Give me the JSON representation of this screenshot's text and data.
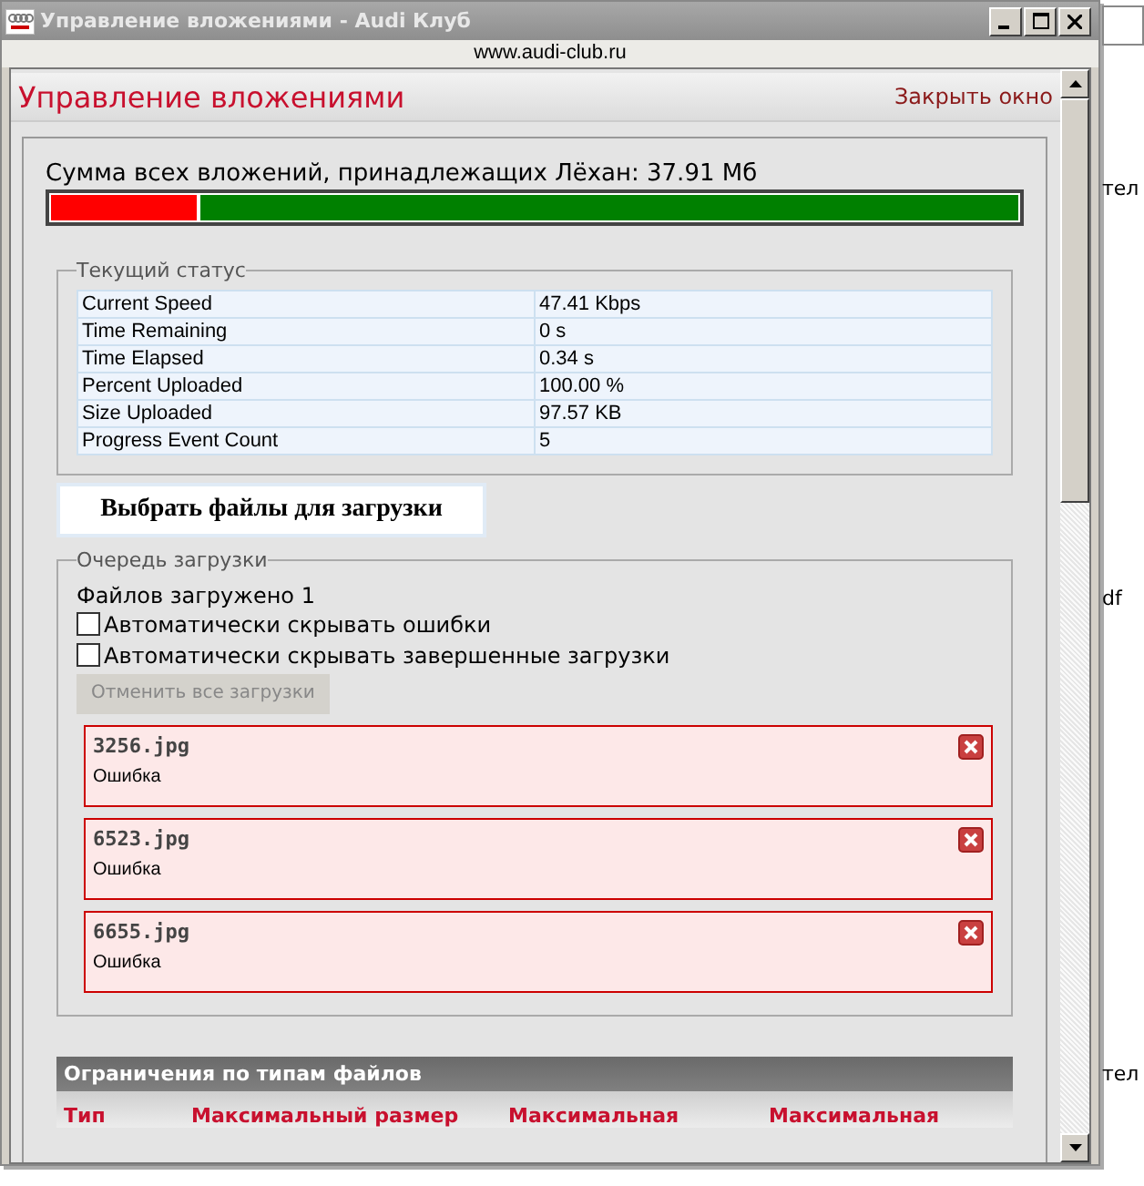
{
  "window": {
    "title": "Управление вложениями - Audi Клуб",
    "url": "www.audi-club.ru"
  },
  "header": {
    "title": "Управление вложениями",
    "close_link": "Закрыть окно"
  },
  "storage": {
    "label": "Сумма всех вложений, принадлежащих Лёхан: 37.91 Мб",
    "level": 0.15
  },
  "status": {
    "legend": "Текущий статус",
    "rows": [
      {
        "name": "Current Speed",
        "value": "47.41 Kbps"
      },
      {
        "name": "Time Remaining",
        "value": "0 s"
      },
      {
        "name": "Time Elapsed",
        "value": "0.34 s"
      },
      {
        "name": "Percent Uploaded",
        "value": "100.00 %"
      },
      {
        "name": "Size Uploaded",
        "value": "97.57 KB"
      },
      {
        "name": "Progress Event Count",
        "value": "5"
      }
    ]
  },
  "select_button": "Выбрать файлы для загрузки",
  "queue": {
    "legend": "Очередь загрузки",
    "count_text": "Файлов загружено 1",
    "options": [
      {
        "label": "Автоматически скрывать ошибки",
        "checked": false
      },
      {
        "label": "Автоматически скрывать завершенные загрузки",
        "checked": false
      }
    ],
    "cancel_button": {
      "label": "Отменить все загрузки",
      "disabled": true
    },
    "files": [
      {
        "name": "3256.jpg",
        "status": "Ошибка"
      },
      {
        "name": "6523.jpg",
        "status": "Ошибка"
      },
      {
        "name": "6655.jpg",
        "status": "Ошибка"
      }
    ]
  },
  "limits": {
    "title": "Ограничения по типам файлов",
    "columns": [
      "Тип",
      "Максимальный размер",
      "Максимальная",
      "Максимальная"
    ]
  },
  "background": {
    "fragments": [
      "тел",
      "df",
      "тел"
    ]
  }
}
